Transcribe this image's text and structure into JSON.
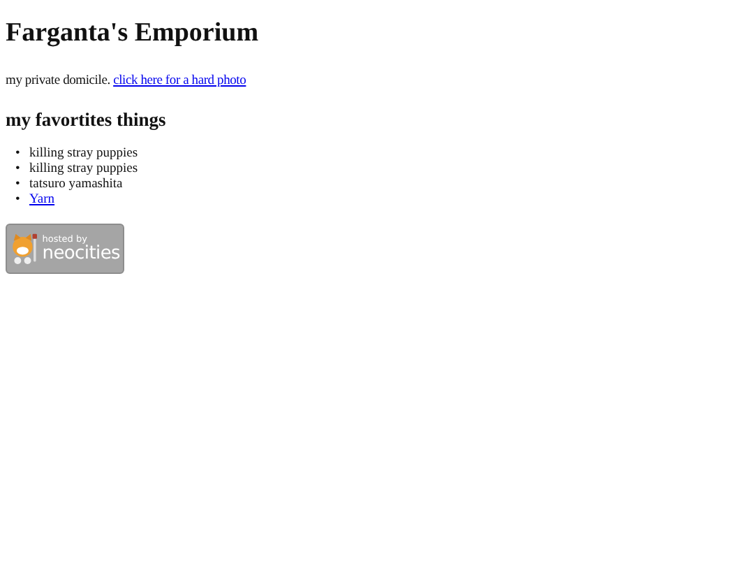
{
  "title": "Farganta's Emporium",
  "intro": {
    "text": "my private domicile.",
    "link": "click here for a hard photo"
  },
  "section_title": "my favortites things",
  "items": [
    {
      "marker": "•",
      "text": "killing stray puppies",
      "kind": "text"
    },
    {
      "marker": "•",
      "text": "killing stray puppies",
      "kind": "text"
    },
    {
      "marker": "•",
      "text": "tatsuro yamashita",
      "kind": "text"
    },
    {
      "marker": "•",
      "text": "Yarn",
      "kind": "link"
    }
  ],
  "badge": {
    "line_1": "hosted by",
    "line_2": "neocities"
  }
}
